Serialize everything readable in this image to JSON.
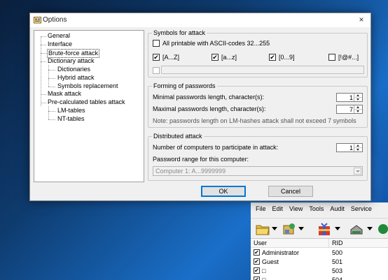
{
  "background_app": {
    "menu": [
      "File",
      "Edit",
      "View",
      "Tools",
      "Audit",
      "Service"
    ],
    "columns": [
      "User",
      "RID"
    ],
    "rows": [
      {
        "user": "Administrator",
        "rid": "500",
        "checked": true
      },
      {
        "user": "Guest",
        "rid": "501",
        "checked": true
      },
      {
        "user": "□",
        "rid": "503",
        "checked": true
      },
      {
        "user": "□",
        "rid": "504",
        "checked": true
      }
    ]
  },
  "dialog": {
    "title": "Options",
    "close_glyph": "×",
    "tree": [
      {
        "label": "General",
        "level": 0
      },
      {
        "label": "Interface",
        "level": 0
      },
      {
        "label": "Brute-force attack",
        "level": 0,
        "selected": true
      },
      {
        "label": "Dictionary attack",
        "level": 0
      },
      {
        "label": "Dictionaries",
        "level": 1
      },
      {
        "label": "Hybrid attack",
        "level": 1
      },
      {
        "label": "Symbols replacement",
        "level": 1
      },
      {
        "label": "Mask attack",
        "level": 0
      },
      {
        "label": "Pre-calculated tables attack",
        "level": 0
      },
      {
        "label": "LM-tables",
        "level": 1
      },
      {
        "label": "NT-tables",
        "level": 1
      }
    ],
    "symbols": {
      "title": "Symbols for attack",
      "all_printable": {
        "label": "All printable with ASCII-codes 32...255",
        "checked": false
      },
      "charsets": [
        {
          "label": "[A...Z]",
          "checked": true
        },
        {
          "label": "[a...z]",
          "checked": true
        },
        {
          "label": "[0...9]",
          "checked": true
        },
        {
          "label": "[!@#...]",
          "checked": false
        }
      ],
      "custom": {
        "checked": false,
        "value": ""
      }
    },
    "forming": {
      "title": "Forming of passwords",
      "min_label": "Minimal passwords length, character(s):",
      "min_value": "1",
      "max_label": "Maximal passwords length, character(s):",
      "max_value": "7",
      "note": "Note: passwords length on LM-hashes attack shall not exceed 7 symbols"
    },
    "distributed": {
      "title": "Distributed attack",
      "computers_label": "Number of computers to participate in attack:",
      "computers_value": "1",
      "range_label": "Password range for this computer:",
      "range_value": "Computer 1: A...9999999"
    },
    "ok_label": "OK",
    "cancel_label": "Cancel",
    "check_glyph": "✔"
  }
}
